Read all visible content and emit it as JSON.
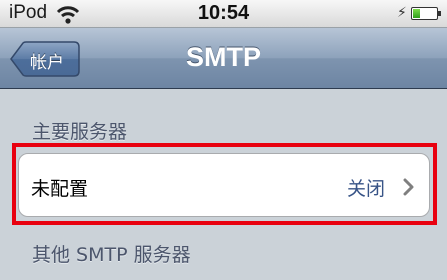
{
  "status_bar": {
    "carrier": "iPod",
    "time": "10:54",
    "battery_level": 0.3
  },
  "nav": {
    "back_label": "帐户",
    "title": "SMTP"
  },
  "sections": {
    "primary_header": "主要服务器",
    "primary_row": {
      "label": "未配置",
      "value": "关闭"
    },
    "other_header": "其他 SMTP 服务器"
  },
  "colors": {
    "highlight": "#e8000f",
    "value_text": "#385487",
    "nav_bar": "#7e94af"
  }
}
